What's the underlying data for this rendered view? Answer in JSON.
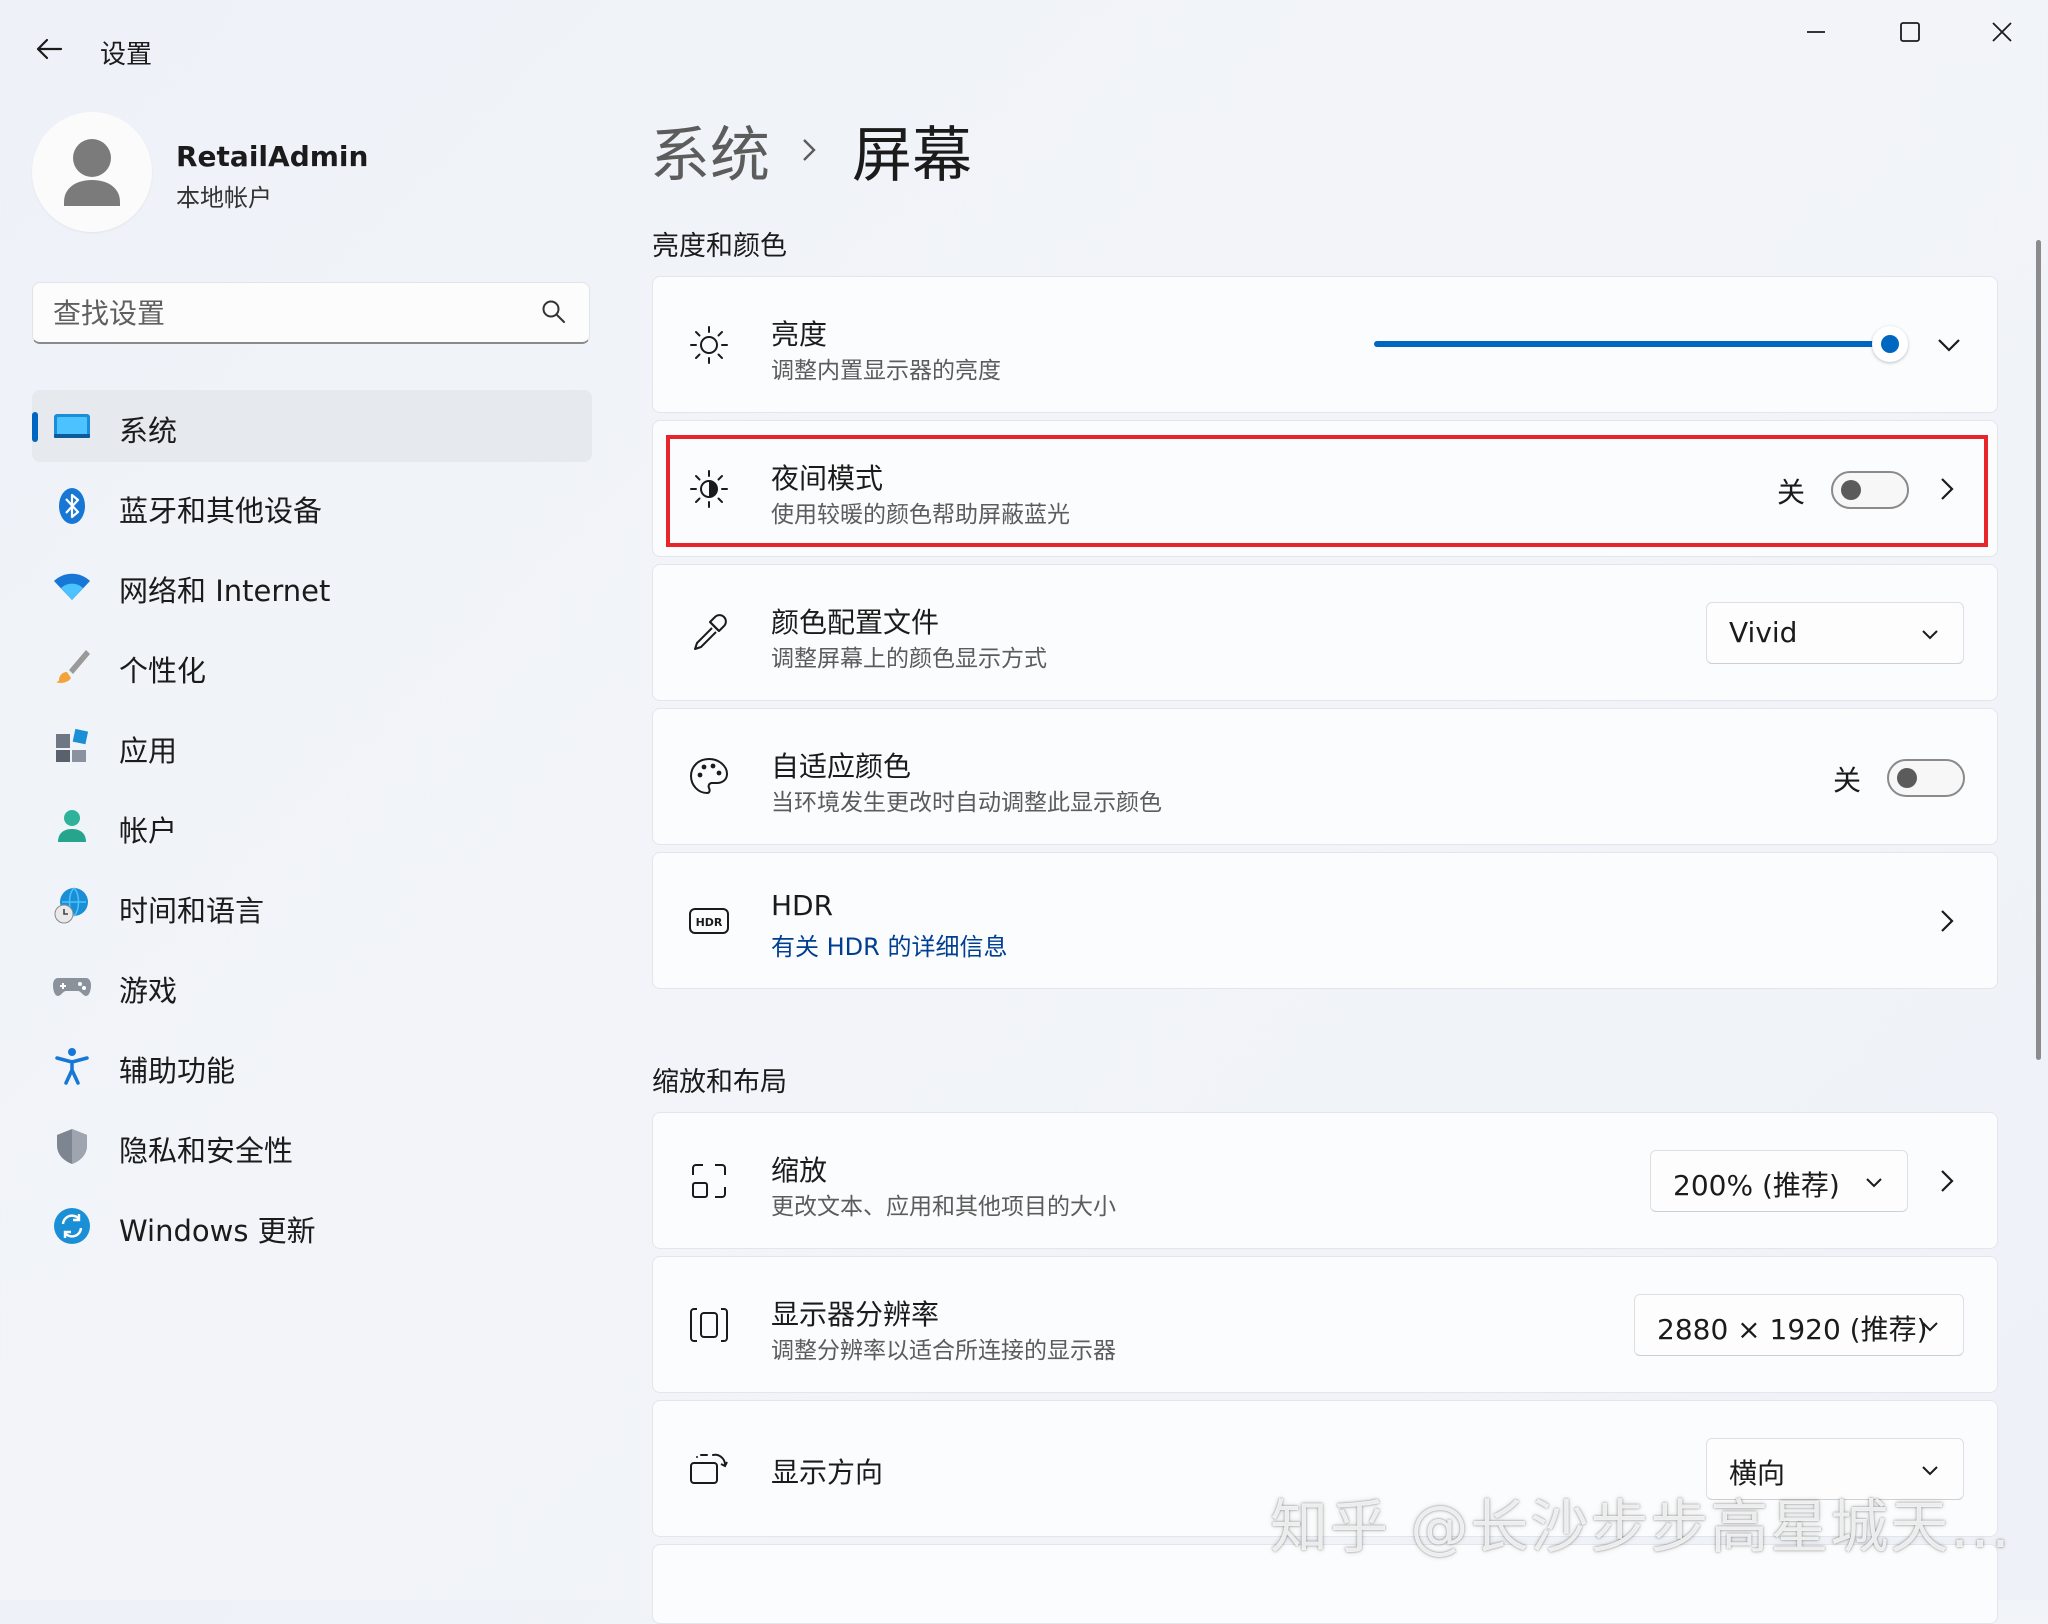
{
  "window": {
    "title": "设置",
    "controls": [
      "minimize-icon",
      "maximize-icon",
      "close-icon"
    ]
  },
  "user": {
    "name": "RetailAdmin",
    "account_type": "本地帐户"
  },
  "search": {
    "placeholder": "查找设置",
    "value": ""
  },
  "sidebar": {
    "items": [
      {
        "label": "系统",
        "icon": "system-icon",
        "selected": true
      },
      {
        "label": "蓝牙和其他设备",
        "icon": "bluetooth-icon"
      },
      {
        "label": "网络和 Internet",
        "icon": "wifi-icon"
      },
      {
        "label": "个性化",
        "icon": "brush-icon"
      },
      {
        "label": "应用",
        "icon": "apps-icon"
      },
      {
        "label": "帐户",
        "icon": "account-icon"
      },
      {
        "label": "时间和语言",
        "icon": "globe-clock-icon"
      },
      {
        "label": "游戏",
        "icon": "gamepad-icon"
      },
      {
        "label": "辅助功能",
        "icon": "accessibility-icon"
      },
      {
        "label": "隐私和安全性",
        "icon": "shield-icon"
      },
      {
        "label": "Windows 更新",
        "icon": "update-icon"
      }
    ]
  },
  "breadcrumb": {
    "parent": "系统",
    "current": "屏幕"
  },
  "sections": {
    "brightness_color": {
      "title": "亮度和颜色",
      "brightness": {
        "title": "亮度",
        "subtitle": "调整内置显示器的亮度",
        "level": 1.0
      },
      "night_light": {
        "title": "夜间模式",
        "subtitle": "使用较暖的颜色帮助屏蔽蓝光",
        "state_label": "关",
        "on": false
      },
      "color_profile": {
        "title": "颜色配置文件",
        "subtitle": "调整屏幕上的颜色显示方式",
        "value": "Vivid"
      },
      "adaptive_color": {
        "title": "自适应颜色",
        "subtitle": "当环境发生更改时自动调整此显示颜色",
        "state_label": "关",
        "on": false
      },
      "hdr": {
        "title": "HDR",
        "link": "有关 HDR 的详细信息"
      }
    },
    "scale_layout": {
      "title": "缩放和布局",
      "scale": {
        "title": "缩放",
        "subtitle": "更改文本、应用和其他项目的大小",
        "value": "200% (推荐)"
      },
      "resolution": {
        "title": "显示器分辨率",
        "subtitle": "调整分辨率以适合所连接的显示器",
        "value": "2880 × 1920 (推荐)"
      },
      "orientation": {
        "title": "显示方向",
        "value": "横向"
      }
    }
  },
  "watermark": "知乎 @长沙步步高星城天...",
  "colors": {
    "accent": "#0067c0",
    "highlight_border": "#e8252a",
    "link": "#003e92"
  }
}
